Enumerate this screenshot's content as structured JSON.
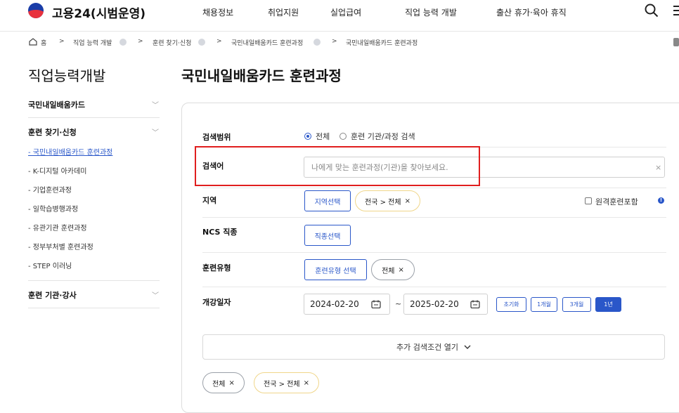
{
  "header": {
    "logo_text": "고용24(시범운영)",
    "nav": [
      "채용정보",
      "취업지원",
      "실업급여",
      "직업 능력 개발",
      "출산 휴가·육아 휴직"
    ],
    "icons": [
      "search-icon",
      "menu-icon"
    ]
  },
  "breadcrumb": {
    "home": "홈",
    "items": [
      "직업 능력 개발",
      "훈련 찾기·신청",
      "국민내일배움카드 훈련과정",
      "국민내일배움카드 훈련과정"
    ]
  },
  "sidebar": {
    "title": "직업능력개발",
    "sections": [
      {
        "label": "국민내일배움카드"
      },
      {
        "label": "훈련 찾기·신청",
        "items": [
          "- 국민내일배움카드 훈련과정",
          "- K-디지털 아카데미",
          "- 기업훈련과정",
          "- 일학습병행과정",
          "- 유관기관 훈련과정",
          "- 정부부처별 훈련과정",
          "- STEP 이러닝"
        ]
      },
      {
        "label": "훈련 기관·강사"
      }
    ]
  },
  "main": {
    "title": "국민내일배움카드 훈련과정",
    "scope": {
      "label": "검색범위",
      "options": [
        "전체",
        "훈련 기관/과정 검색"
      ],
      "selected": "전체"
    },
    "keyword": {
      "label": "검색어",
      "placeholder": "나에게 맞는 훈련과정(기관)을 찾아보세요.",
      "clear": "×"
    },
    "region": {
      "label": "지역",
      "button": "지역선택",
      "tag": "전국 > 전체",
      "remote_label": "원격훈련포함",
      "info": "!"
    },
    "ncs": {
      "label": "NCS 직종",
      "button": "직종선택"
    },
    "type": {
      "label": "훈련유형",
      "button": "훈련유형 선택",
      "tag": "전체"
    },
    "date": {
      "label": "개강일자",
      "from": "2024-02-20",
      "sep": "~",
      "to": "2025-02-20",
      "buttons": [
        "초기화",
        "1개월",
        "3개월",
        "1년"
      ],
      "active": "1년"
    },
    "more_label": "추가 검색조건 열기",
    "selected_tags": [
      "전체",
      "전국 > 전체"
    ]
  },
  "colors": {
    "accent": "#2a57c9",
    "highlight": "#e01e1e",
    "tag_border": "#f0d68a"
  }
}
